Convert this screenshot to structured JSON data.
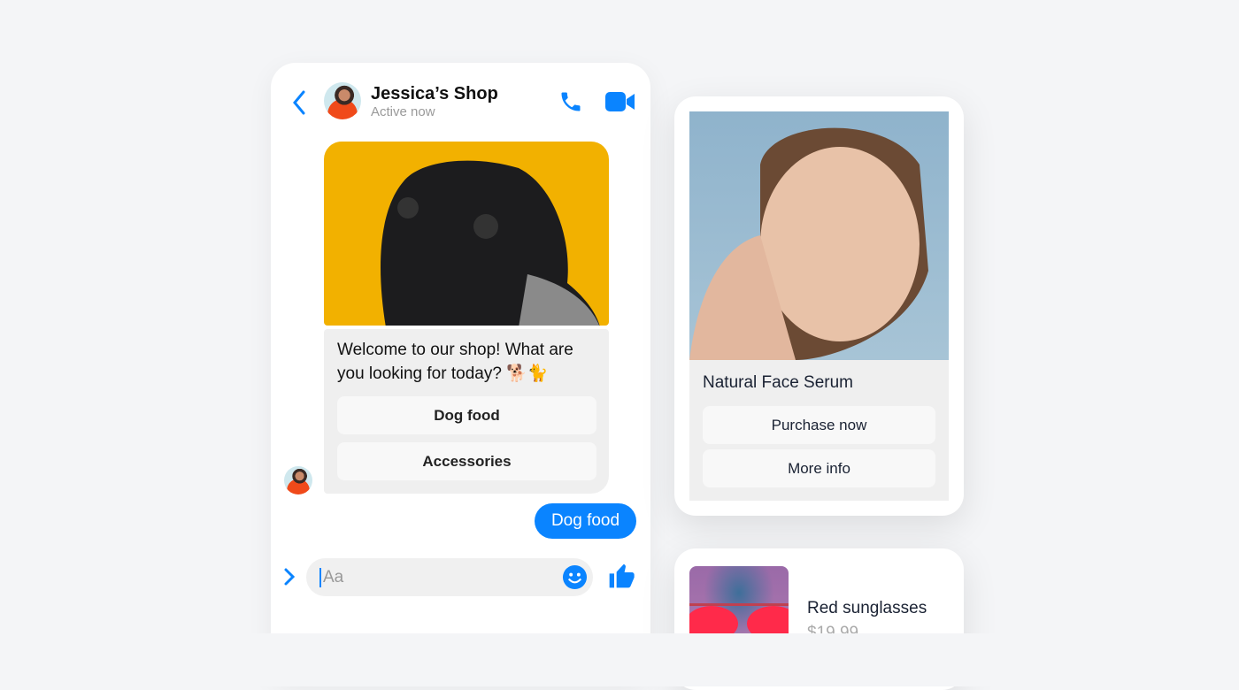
{
  "chat": {
    "title": "Jessica’s Shop",
    "status": "Active now",
    "message": "Welcome to our shop! What are you looking for today? 🐕🐈",
    "quick_replies": [
      "Dog food",
      "Accessories"
    ],
    "sent_message": "Dog food",
    "input_placeholder": "Aa",
    "accent": "#0a84ff"
  },
  "product_card": {
    "title": "Natural Face Serum",
    "buttons": [
      "Purchase now",
      "More info"
    ]
  },
  "product_card_2": {
    "title": "Red sunglasses",
    "price": "$19.99"
  }
}
